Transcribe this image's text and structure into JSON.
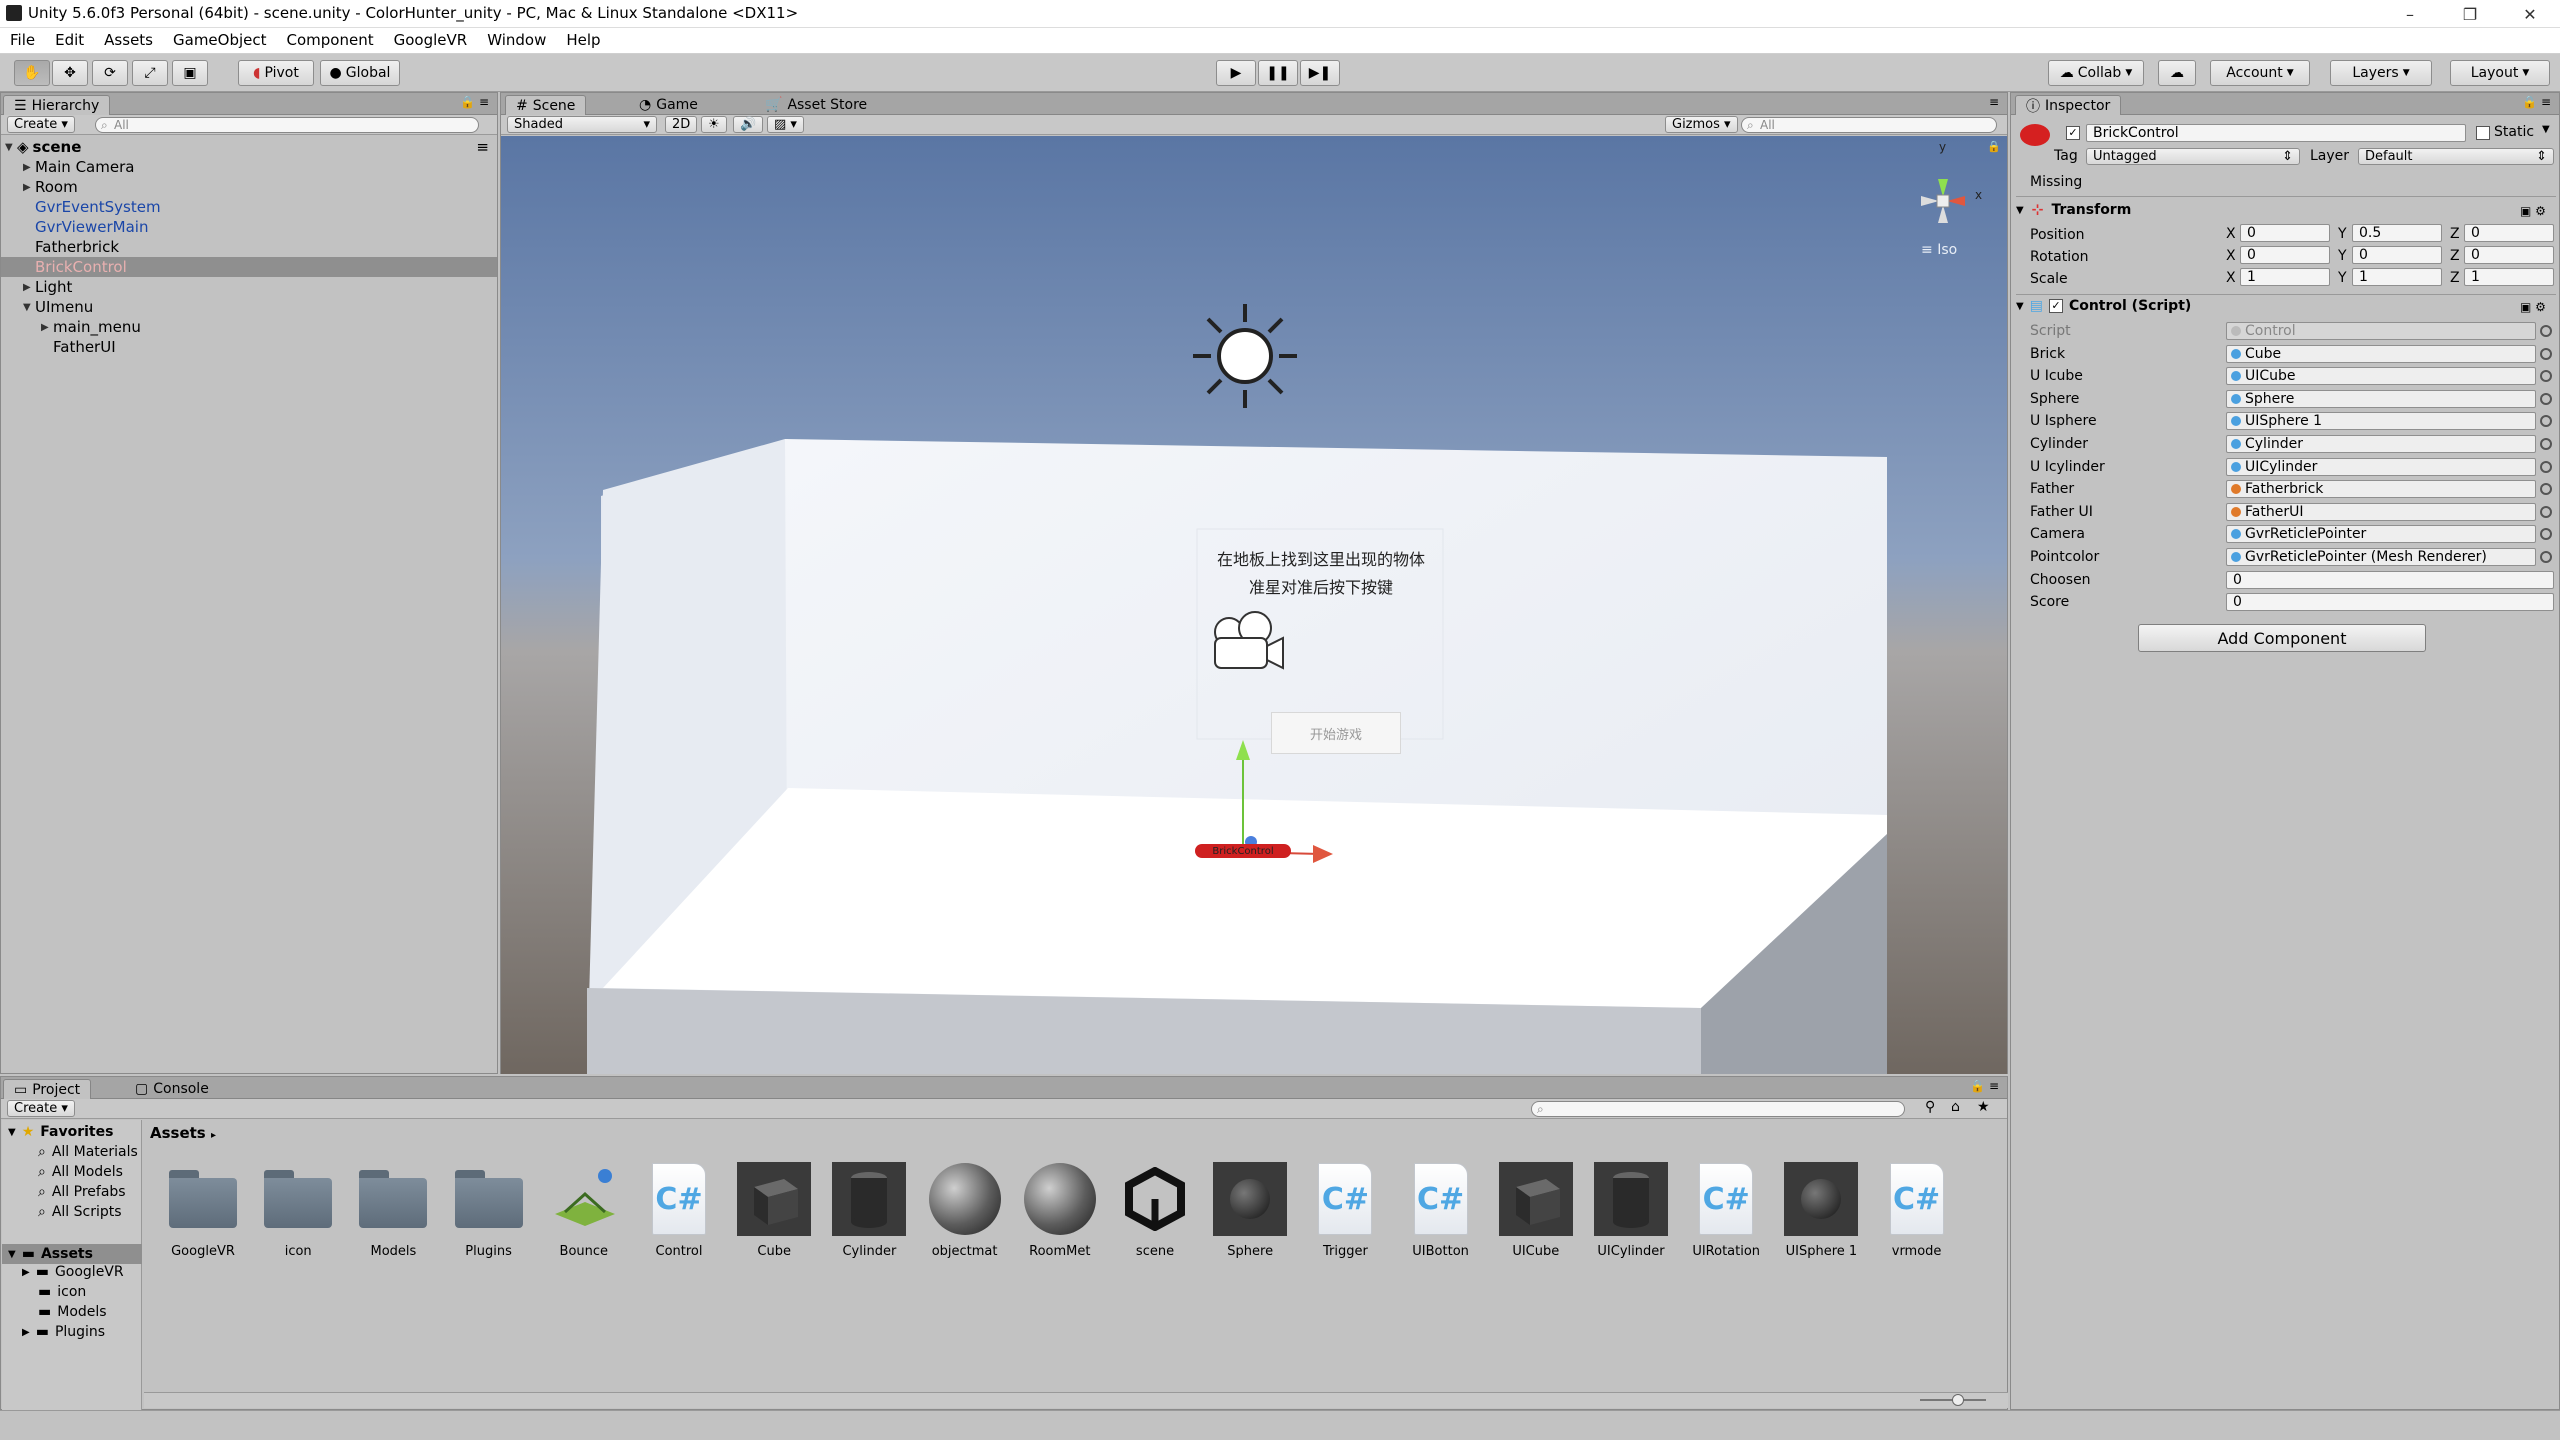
{
  "window": {
    "title": "Unity 5.6.0f3 Personal (64bit) - scene.unity - ColorHunter_unity - PC, Mac & Linux Standalone <DX11>",
    "controls": [
      "–",
      "❐",
      "✕"
    ]
  },
  "menubar": [
    "File",
    "Edit",
    "Assets",
    "GameObject",
    "Component",
    "GoogleVR",
    "Window",
    "Help"
  ],
  "toolbar": {
    "pivot": "Pivot",
    "global": "Global",
    "collab": "Collab",
    "account": "Account",
    "layers": "Layers",
    "layout": "Layout"
  },
  "hierarchy": {
    "tab": "Hierarchy",
    "create": "Create",
    "search_placeholder": "All",
    "scene": "scene",
    "items": [
      {
        "label": "Main Camera",
        "arrow": "▶"
      },
      {
        "label": "Room",
        "arrow": "▶"
      },
      {
        "label": "GvrEventSystem",
        "arrow": ""
      },
      {
        "label": "GvrViewerMain",
        "arrow": ""
      },
      {
        "label": "Fatherbrick",
        "arrow": ""
      },
      {
        "label": "BrickControl",
        "arrow": ""
      },
      {
        "label": "Light",
        "arrow": "▶"
      },
      {
        "label": "UImenu",
        "arrow": "▼"
      },
      {
        "label": "main_menu",
        "arrow": "▶"
      },
      {
        "label": "FatherUI",
        "arrow": ""
      }
    ]
  },
  "sceneview": {
    "tabs": [
      "Scene",
      "Game",
      "Asset Store"
    ],
    "shading": "Shaded",
    "mode2d": "2D",
    "gizmos": "Gizmos",
    "search_placeholder": "All",
    "iso": "Iso",
    "axis_y": "y",
    "axis_x": "x",
    "ui_text_line1": "在地板上找到这里出现的物体",
    "ui_text_line2": "准星对准后按下按键",
    "ui_button": "开始游戏",
    "brick_label": "BrickControl"
  },
  "inspector": {
    "tab": "Inspector",
    "object_name": "BrickControl",
    "static_label": "Static",
    "tag_label": "Tag",
    "tag_value": "Untagged",
    "layer_label": "Layer",
    "layer_value": "Default",
    "missing": "Missing",
    "transform": {
      "title": "Transform",
      "rows": [
        {
          "label": "Position",
          "x": "0",
          "y": "0.5",
          "z": "0"
        },
        {
          "label": "Rotation",
          "x": "0",
          "y": "0",
          "z": "0"
        },
        {
          "label": "Scale",
          "x": "1",
          "y": "1",
          "z": "1"
        }
      ]
    },
    "script": {
      "title": "Control (Script)",
      "fields": [
        {
          "label": "Script",
          "value": "Control"
        },
        {
          "label": "Brick",
          "value": "Cube"
        },
        {
          "label": "U Icube",
          "value": "UICube"
        },
        {
          "label": "Sphere",
          "value": "Sphere"
        },
        {
          "label": "U Isphere",
          "value": "UISphere 1"
        },
        {
          "label": "Cylinder",
          "value": "Cylinder"
        },
        {
          "label": "U Icylinder",
          "value": "UICylinder"
        },
        {
          "label": "Father",
          "value": "Fatherbrick"
        },
        {
          "label": "Father UI",
          "value": "FatherUI"
        },
        {
          "label": "Camera",
          "value": "GvrReticlePointer"
        },
        {
          "label": "Pointcolor",
          "value": "GvrReticlePointer (Mesh Renderer)"
        },
        {
          "label": "Choosen",
          "value": "0"
        },
        {
          "label": "Score",
          "value": "0"
        }
      ]
    },
    "add_component": "Add Component"
  },
  "project": {
    "tabs": [
      "Project",
      "Console"
    ],
    "create": "Create",
    "favorites_label": "Favorites",
    "favorites": [
      "All Materials",
      "All Models",
      "All Prefabs",
      "All Scripts"
    ],
    "assets_label": "Assets",
    "tree": [
      "GoogleVR",
      "icon",
      "Models",
      "Plugins"
    ],
    "breadcrumb": "Assets",
    "assets": [
      {
        "name": "GoogleVR",
        "kind": "folder"
      },
      {
        "name": "icon",
        "kind": "folder"
      },
      {
        "name": "Models",
        "kind": "folder"
      },
      {
        "name": "Plugins",
        "kind": "folder"
      },
      {
        "name": "Bounce",
        "kind": "physmat"
      },
      {
        "name": "Control",
        "kind": "script"
      },
      {
        "name": "Cube",
        "kind": "cube"
      },
      {
        "name": "Cylinder",
        "kind": "cylinder"
      },
      {
        "name": "objectmat",
        "kind": "material"
      },
      {
        "name": "RoomMet",
        "kind": "material"
      },
      {
        "name": "scene",
        "kind": "unity"
      },
      {
        "name": "Sphere",
        "kind": "sphere-prefab"
      },
      {
        "name": "Trigger",
        "kind": "script"
      },
      {
        "name": "UIBotton",
        "kind": "script"
      },
      {
        "name": "UICube",
        "kind": "cube"
      },
      {
        "name": "UICylinder",
        "kind": "cylinder"
      },
      {
        "name": "UIRotation",
        "kind": "script"
      },
      {
        "name": "UISphere 1",
        "kind": "sphere-prefab"
      },
      {
        "name": "vrmode",
        "kind": "script"
      }
    ]
  },
  "colors": {
    "accent_blue": "#1a46a8",
    "selected_pink": "#e8b0b0",
    "brick_red": "#d52020",
    "sky_top": "#5b77a5",
    "ground": "#6f6760"
  }
}
